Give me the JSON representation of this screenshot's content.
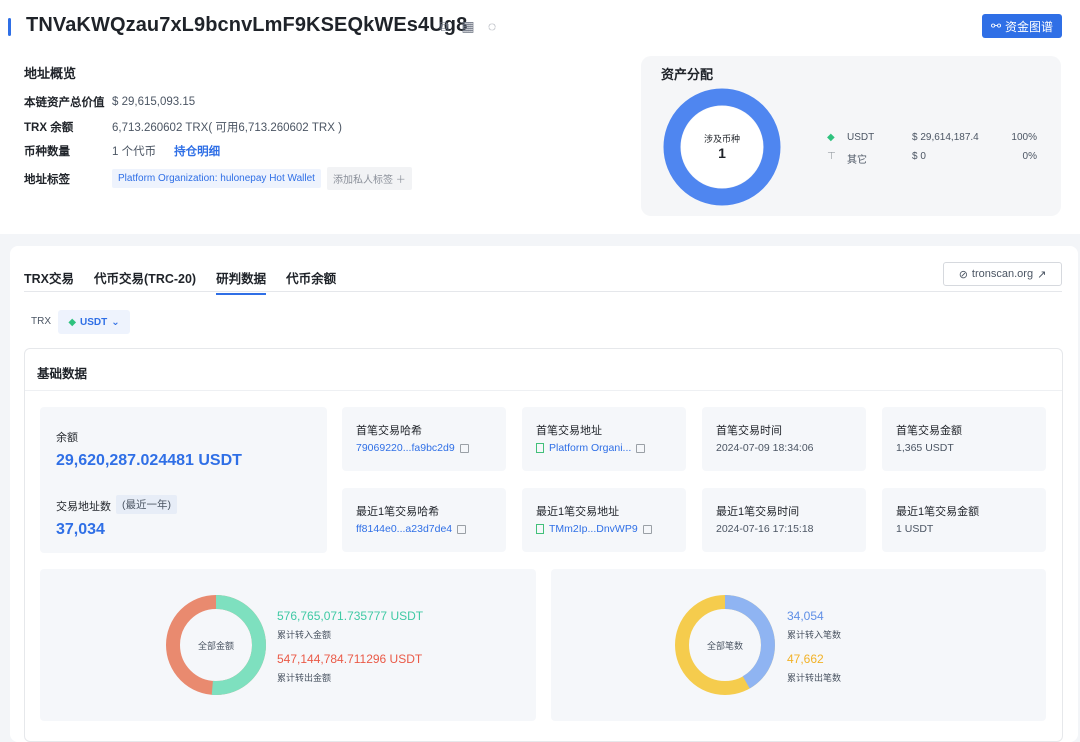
{
  "header": {
    "address": "TNVaKWQzau7xL9bcnvLmF9KSEQkWEs4Ug8",
    "fund_graph_label": "资金图谱"
  },
  "overview": {
    "title": "地址概览",
    "total_value_label": "本链资产总价值",
    "total_value": "$ 29,615,093.15",
    "trx_balance_label": "TRX 余额",
    "trx_balance": "6,713.260602 TRX( 可用6,713.260602 TRX )",
    "token_count_label": "币种数量",
    "token_count": "1 个代币",
    "holdings_link": "持仓明细",
    "tags_label": "地址标签",
    "tag_1": "Platform Organization: hulonepay Hot Wallet",
    "add_private_tag": "添加私人标签"
  },
  "assets": {
    "title": "资产分配",
    "donut_label": "涉及币种",
    "donut_value": "1",
    "rows": [
      {
        "name": "USDT",
        "value": "$ 29,614,187.4",
        "pct": "100%",
        "share": 100
      },
      {
        "name": "其它",
        "value": "$ 0",
        "pct": "0%",
        "share": 0
      }
    ]
  },
  "tabs": [
    "TRX交易",
    "代币交易(TRC-20)",
    "研判数据",
    "代币余额"
  ],
  "active_tab": 2,
  "tronscan_label": "tronscan.org",
  "token_switch": {
    "trx": "TRX",
    "usdt": "USDT"
  },
  "basic": {
    "title": "基础数据",
    "balance_label": "余额",
    "balance_value": "29,620,287.024481 USDT",
    "addr_count_label": "交易地址数",
    "addr_count_chip": "(最近一年)",
    "addr_count_value": "37,034",
    "first_hash_label": "首笔交易哈希",
    "first_hash": "79069220...fa9bc2d9",
    "first_addr_label": "首笔交易地址",
    "first_addr": "Platform Organi...",
    "first_time_label": "首笔交易时间",
    "first_time": "2024-07-09 18:34:06",
    "first_amount_label": "首笔交易金额",
    "first_amount": "1,365 USDT",
    "last_hash_label": "最近1笔交易哈希",
    "last_hash": "ff8144e0...a23d7de4",
    "last_addr_label": "最近1笔交易地址",
    "last_addr": "TMm2Ip...DnvWP9",
    "last_time_label": "最近1笔交易时间",
    "last_time": "2024-07-16 17:15:18",
    "last_amount_label": "最近1笔交易金额",
    "last_amount": "1 USDT"
  },
  "amount_chart": {
    "center_label": "全部金额",
    "in_value": "576,765,071.735777 USDT",
    "in_label": "累计转入金额",
    "out_value": "547,144,784.711296 USDT",
    "out_label": "累计转出金额",
    "in_share": 51.3,
    "colors": {
      "in": "#7ee0bf",
      "out": "#e98a6f"
    }
  },
  "count_chart": {
    "center_label": "全部笔数",
    "in_value": "34,054",
    "in_label": "累计转入笔数",
    "out_value": "47,662",
    "out_label": "累计转出笔数",
    "in_share": 41.7,
    "colors": {
      "in": "#8fb4f2",
      "out": "#f5cc4d"
    }
  }
}
